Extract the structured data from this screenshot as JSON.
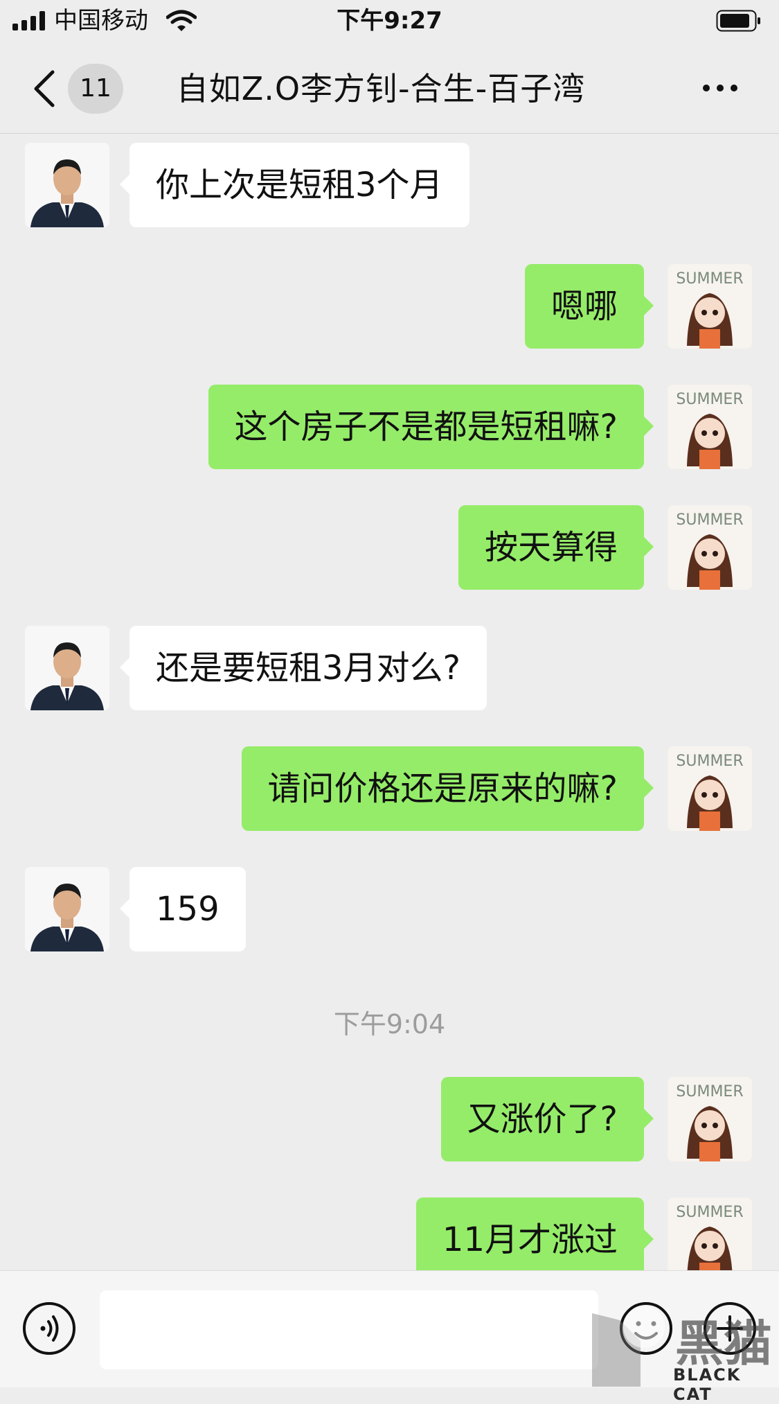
{
  "status_bar": {
    "carrier": "中国移动",
    "time": "下午9:27"
  },
  "nav": {
    "unread_count": "11",
    "title": "自如Z.O李方钊-合生-百子湾"
  },
  "messages": [
    {
      "side": "in",
      "text": "你上次是短租3个月"
    },
    {
      "side": "out",
      "text": "嗯哪"
    },
    {
      "side": "out",
      "text": "这个房子不是都是短租嘛?"
    },
    {
      "side": "out",
      "text": "按天算得"
    },
    {
      "side": "in",
      "text": "还是要短租3月对么?"
    },
    {
      "side": "out",
      "text": "请问价格还是原来的嘛?"
    },
    {
      "side": "in",
      "text": "159"
    },
    {
      "side": "time",
      "text": "下午9:04"
    },
    {
      "side": "out",
      "text": "又涨价了?"
    },
    {
      "side": "out",
      "text": "11月才涨过"
    }
  ],
  "avatar_text": "SUMMER",
  "watermark": {
    "text": "BLACK CAT",
    "logo_text": "黑猫"
  },
  "colors": {
    "background": "#ededed",
    "outgoing_bubble": "#95ec69",
    "incoming_bubble": "#ffffff"
  }
}
